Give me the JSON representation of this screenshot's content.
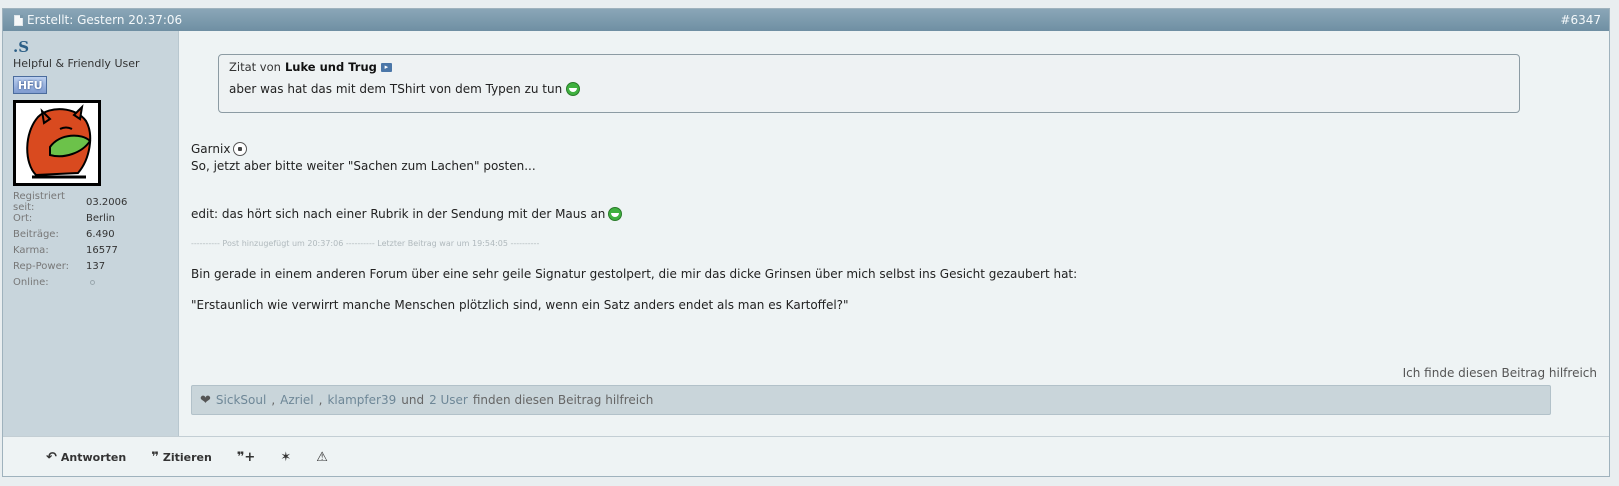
{
  "header": {
    "created": "Erstellt: Gestern 20:37:06",
    "post_number": "#6347"
  },
  "user": {
    "name": ".S",
    "title": "Helpful & Friendly User",
    "badge": "HFU",
    "stats": [
      {
        "label": "Registriert seit:",
        "value": "03.2006"
      },
      {
        "label": "Ort:",
        "value": "Berlin"
      },
      {
        "label": "Beiträge:",
        "value": "6.490"
      },
      {
        "label": "Karma:",
        "value": "16577"
      },
      {
        "label": "Rep-Power:",
        "value": "137"
      },
      {
        "label": "Online:",
        "value": ""
      }
    ]
  },
  "quote": {
    "prefix": "Zitat von",
    "author": "Luke und Trug",
    "text": "aber was hat das mit dem TShirt von dem Typen zu tun"
  },
  "body": {
    "line1": "Garnix",
    "line2": "So, jetzt aber bitte weiter \"Sachen zum Lachen\" posten...",
    "edit": "edit: das hört sich nach einer Rubrik in der Sendung mit der Maus an",
    "separator": "---------- Post hinzugefügt um 20:37:06 ---------- Letzter Beitrag war um 19:54:05 ----------",
    "line3": "Bin gerade in einem anderen Forum über eine sehr geile Signatur gestolpert, die mir das dicke Grinsen über mich selbst ins Gesicht gezaubert hat:",
    "line4": "\"Erstaunlich wie verwirrt manche Menschen plötzlich sind, wenn ein Satz anders endet als man es Kartoffel?\""
  },
  "helpful_link": "Ich finde diesen Beitrag hilfreich",
  "thanks": {
    "names": [
      "SickSoul",
      "Azriel",
      "klampfer39"
    ],
    "connector": "und",
    "others": "2 User",
    "suffix": "finden diesen Beitrag hilfreich"
  },
  "footer": {
    "reply": "Antworten",
    "quote": "Zitieren"
  },
  "icons": {
    "doc": "document-icon",
    "jump": "jump-to-post-icon",
    "grin": "grin-smiley-icon",
    "ball": "soccer-ball-smiley-icon",
    "heart": "heart-icon",
    "reply": "reply-arrow-icon",
    "quote": "quote-bubble-icon",
    "multiquote": "multiquote-plus-icon",
    "thanks": "star-icon",
    "report": "warning-triangle-icon"
  },
  "colors": {
    "header": "#7b98aa",
    "sidebar": "#c8d5dc",
    "username": "#2c5f86",
    "grin": "#3fb13f"
  }
}
